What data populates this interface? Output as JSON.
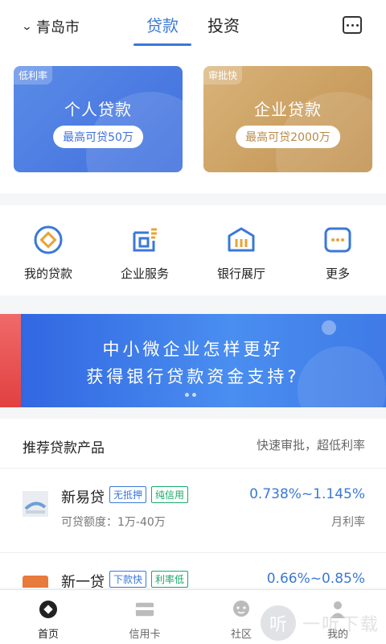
{
  "header": {
    "city": "青岛市",
    "tabs": [
      {
        "label": "贷款",
        "active": true
      },
      {
        "label": "投资",
        "active": false
      }
    ]
  },
  "cards": {
    "personal": {
      "tag": "低利率",
      "title": "个人贷款",
      "limit": "最高可贷50万"
    },
    "business": {
      "tag": "审批快",
      "title": "企业贷款",
      "limit": "最高可贷2000万"
    }
  },
  "quick": [
    {
      "label": "我的贷款",
      "icon": "my-loan-icon"
    },
    {
      "label": "企业服务",
      "icon": "enterprise-service-icon"
    },
    {
      "label": "银行展厅",
      "icon": "bank-hall-icon"
    },
    {
      "label": "更多",
      "icon": "more-icon"
    }
  ],
  "banner": {
    "line1": "中小微企业怎样更好",
    "line2": "获得银行贷款资金支持?"
  },
  "products_section": {
    "title": "推荐贷款产品",
    "subtitle": "快速审批，超低利率",
    "items": [
      {
        "name": "新易贷",
        "tags": [
          "无抵押",
          "纯信用"
        ],
        "amount": "可贷额度：1万-40万",
        "rate": "0.738%~1.145%",
        "rate_label": "月利率"
      },
      {
        "name": "新一贷",
        "tags": [
          "下款快",
          "利率低"
        ],
        "amount": "",
        "rate": "0.66%~0.85%",
        "rate_label": ""
      }
    ]
  },
  "tabbar": [
    {
      "label": "首页",
      "icon": "home-icon",
      "active": true
    },
    {
      "label": "信用卡",
      "icon": "credit-card-icon",
      "active": false
    },
    {
      "label": "社区",
      "icon": "community-icon",
      "active": false
    },
    {
      "label": "我的",
      "icon": "profile-icon",
      "active": false
    }
  ],
  "watermark": {
    "glyph": "听",
    "text": "一听下载"
  },
  "colors": {
    "accent": "#3a78d8",
    "gold": "#c0914f",
    "green": "#19a86a"
  }
}
